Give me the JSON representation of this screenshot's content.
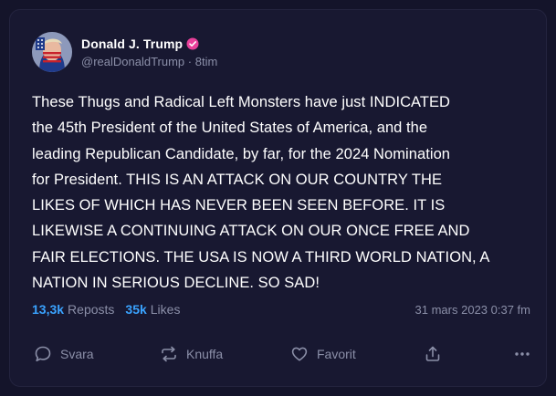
{
  "post": {
    "author": {
      "display_name": "Donald J. Trump",
      "handle": "@realDonaldTrump",
      "separator": "·",
      "time_ago": "8tim",
      "verified_color": "#e8409a"
    },
    "text": "These Thugs and Radical Left Monsters have just INDICATED\nthe 45th President of the United States of America, and the\nleading Republican Candidate, by far, for the 2024 Nomination\nfor President. THIS IS AN ATTACK ON OUR COUNTRY THE\nLIKES OF WHICH HAS NEVER BEEN SEEN BEFORE. IT IS\nLIKEWISE A CONTINUING ATTACK ON OUR ONCE FREE AND\nFAIR ELECTIONS. THE USA IS NOW A THIRD WORLD NATION, A\nNATION IN SERIOUS DECLINE. SO SAD!",
    "stats": {
      "reposts_count": "13,3k",
      "reposts_label": "Reposts",
      "likes_count": "35k",
      "likes_label": "Likes"
    },
    "timestamp": "31 mars 2023 0:37 fm"
  },
  "actions": {
    "reply_label": "Svara",
    "repost_label": "Knuffa",
    "like_label": "Favorit"
  },
  "icons": {
    "reply": "chat-bubble-icon",
    "repost": "repost-arrows-icon",
    "like": "heart-icon",
    "share": "share-icon",
    "more": "more-dots-icon",
    "verified": "verified-badge-icon"
  },
  "colors": {
    "background": "#14142a",
    "card": "#181831",
    "accent": "#3aa3ff",
    "muted": "#8b8fa8",
    "text": "#ffffff"
  }
}
